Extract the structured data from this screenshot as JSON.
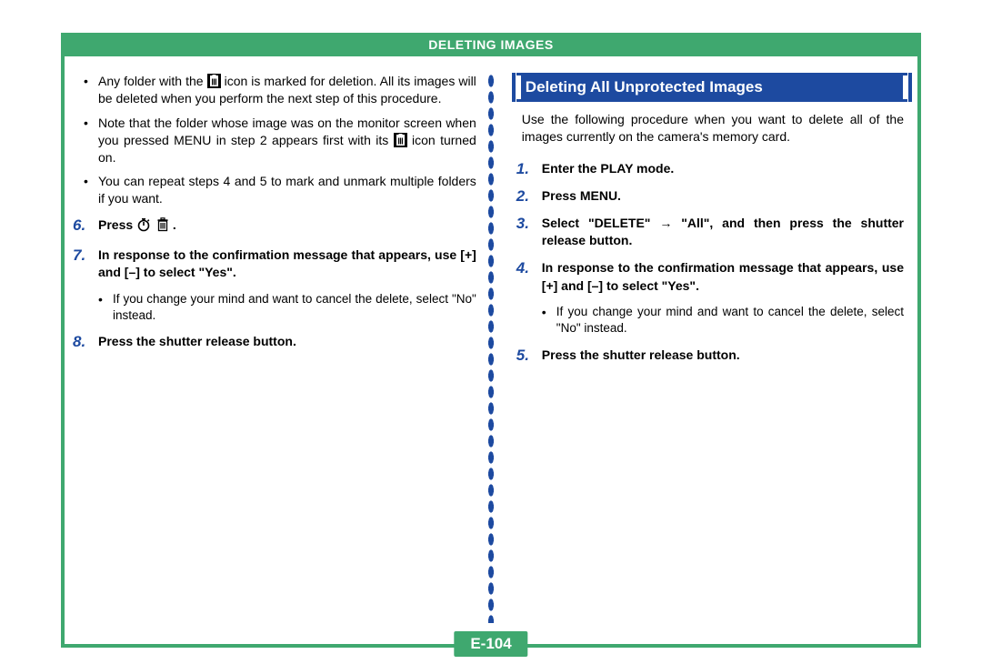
{
  "header": {
    "title": "DELETING IMAGES"
  },
  "left": {
    "bullets": [
      {
        "pre": "Any folder with the ",
        "icon": "trash-filled",
        "post": " icon is marked for deletion. All its images will be deleted when you perform the next step of this procedure."
      },
      {
        "pre": "Note that the folder whose image was on the monitor screen when you pressed MENU in step 2 appears first with its ",
        "icon": "trash-filled",
        "post": " icon turned on."
      },
      {
        "text": "You can repeat steps 4 and 5 to mark and unmark multiple folders if you want."
      }
    ],
    "steps": [
      {
        "num": "6.",
        "pre": "Press ",
        "icon1": "timer",
        "icon2": "trash-outline",
        "post": " ."
      },
      {
        "num": "7.",
        "text": "In response to the confirmation message that appears, use [+] and [–] to select \"Yes\"."
      }
    ],
    "sub7": "If you change your mind and want to cancel the delete, select \"No\" instead.",
    "step8": {
      "num": "8.",
      "text": "Press the shutter release button."
    }
  },
  "right": {
    "section_title": "Deleting All Unprotected Images",
    "intro": "Use the following procedure when you want to delete all of the images currently on the camera's memory card.",
    "steps": [
      {
        "num": "1.",
        "text": "Enter the PLAY mode."
      },
      {
        "num": "2.",
        "text": "Press MENU."
      },
      {
        "num": "3.",
        "pre": "Select \"DELETE\" ",
        "arrow": "→",
        "post": " \"All\", and then press the shutter release button."
      },
      {
        "num": "4.",
        "text": "In response to the confirmation message that appears, use [+] and [–] to select \"Yes\"."
      }
    ],
    "sub4": "If you change your mind and want to cancel the delete, select \"No\" instead.",
    "step5": {
      "num": "5.",
      "text": "Press the shutter release button."
    }
  },
  "page_number": "E-104"
}
